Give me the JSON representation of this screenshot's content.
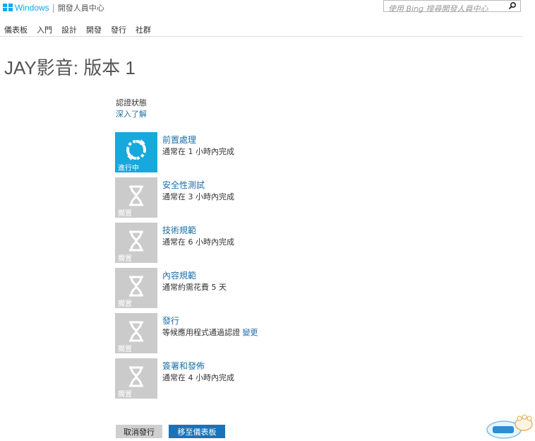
{
  "header": {
    "brand": "Windows",
    "site_name": "開發人員中心",
    "search_placeholder": "使用 Bing 搜尋開發人員中心"
  },
  "nav": {
    "items": [
      {
        "label": "儀表板"
      },
      {
        "label": "入門"
      },
      {
        "label": "設計"
      },
      {
        "label": "開發"
      },
      {
        "label": "發行"
      },
      {
        "label": "社群"
      }
    ]
  },
  "page": {
    "title": "JAY影音: 版本 1",
    "status_heading": "認證狀態",
    "learn_more": "深入了解"
  },
  "steps": [
    {
      "name": "前置處理",
      "desc": "通常在 1 小時內完成",
      "status": "進行中",
      "icon": "refresh-icon"
    },
    {
      "name": "安全性測試",
      "desc": "通常在 3 小時內完成",
      "status": "擱置",
      "icon": "hourglass-icon"
    },
    {
      "name": "技術規範",
      "desc": "通常在 6 小時內完成",
      "status": "擱置",
      "icon": "hourglass-icon"
    },
    {
      "name": "內容規範",
      "desc": "通常約需花費 5 天",
      "status": "擱置",
      "icon": "hourglass-icon"
    },
    {
      "name": "發行",
      "desc": "等候應用程式通過認證",
      "desc_link": "變更",
      "status": "擱置",
      "icon": "hourglass-icon"
    },
    {
      "name": "簽署和發佈",
      "desc": "通常在 4 小時內完成",
      "status": "擱置",
      "icon": "hourglass-icon"
    }
  ],
  "buttons": {
    "cancel": "取消發行",
    "dashboard": "移至儀表板"
  },
  "colors": {
    "accent": "#17a8dc",
    "pending_tile": "#cbcbcb",
    "link": "#1e6fa8",
    "primary_button": "#1a73b8"
  }
}
